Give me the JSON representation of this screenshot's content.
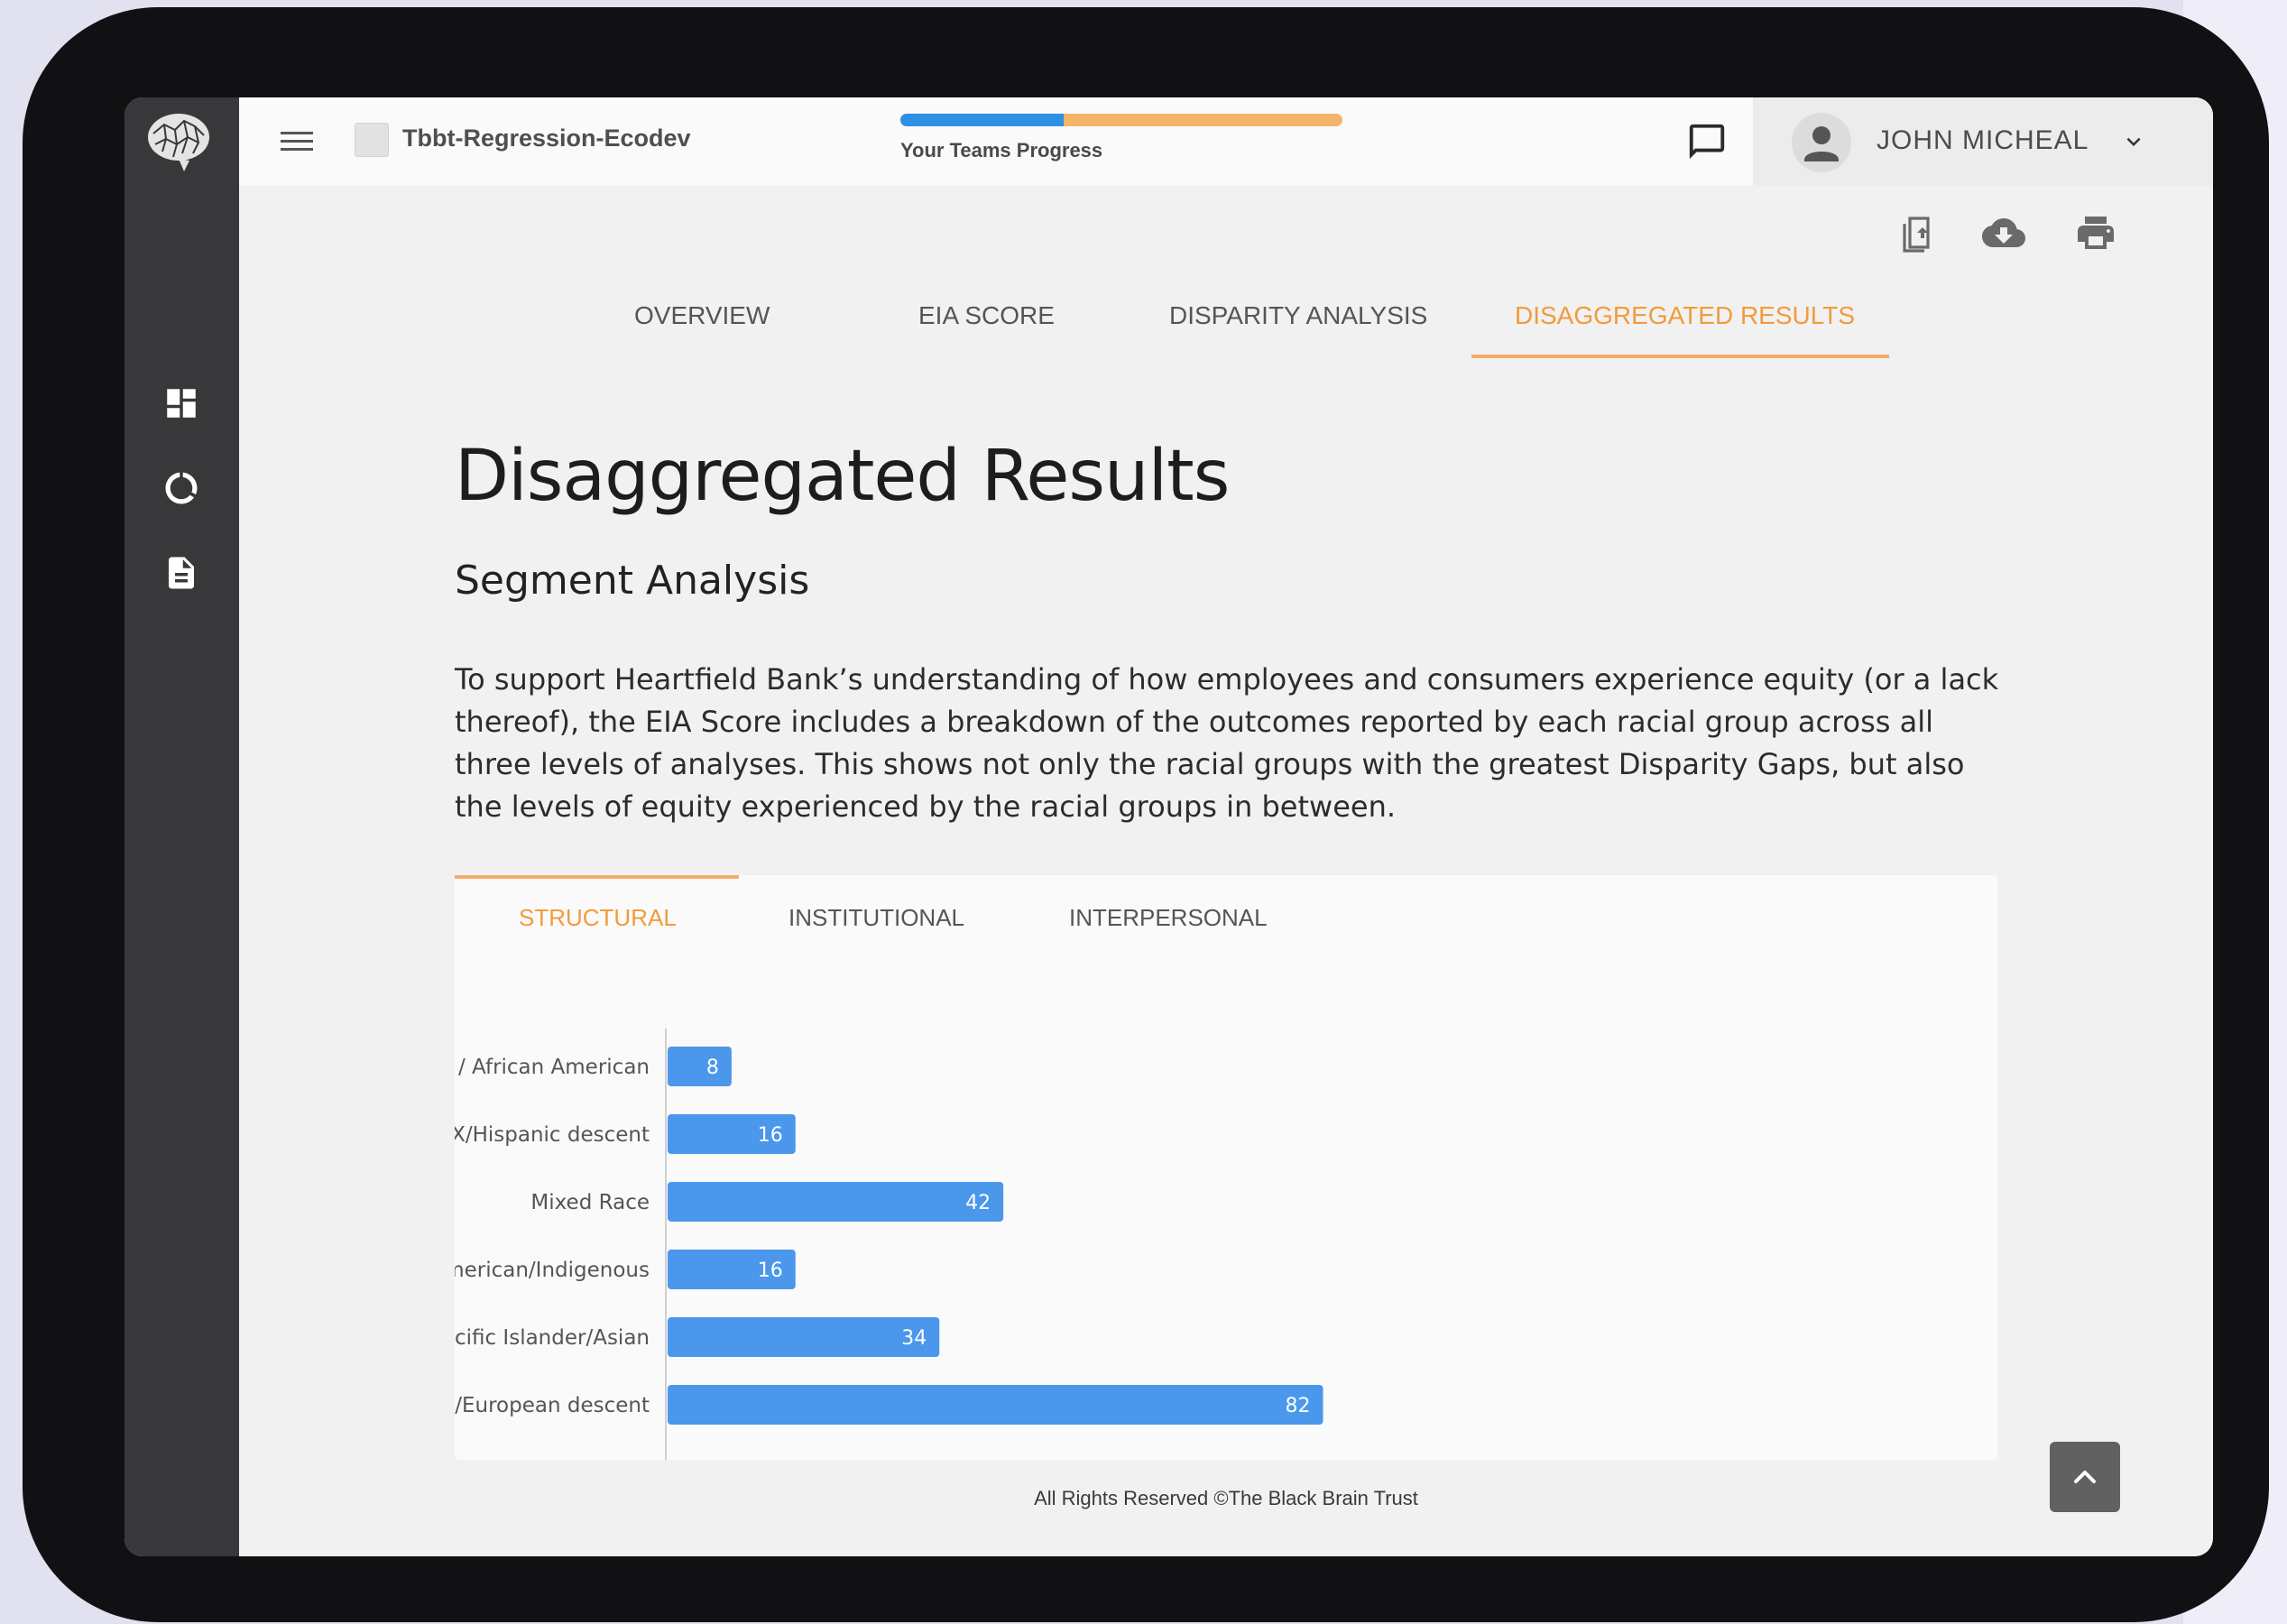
{
  "header": {
    "project_name": "Tbbt-Regression-Ecodev",
    "progress_label": "Your Teams Progress",
    "progress_fraction": 0.37,
    "user_name": "JOHN MICHEAL"
  },
  "tabs": [
    {
      "label": "OVERVIEW",
      "active": false
    },
    {
      "label": "EIA SCORE",
      "active": false
    },
    {
      "label": "DISPARITY ANALYSIS",
      "active": false
    },
    {
      "label": "DISAGGREGATED RESULTS",
      "active": true
    }
  ],
  "page": {
    "title": "Disaggregated Results",
    "subtitle": "Segment Analysis",
    "description": "To support Heartfield Bank’s understanding of how employees and consumers experience equity (or a lack thereof), the EIA Score includes a breakdown of the outcomes reported by each racial group across all three levels of analyses. This shows not only the racial groups with the greatest Disparity Gaps, but also the levels of equity experienced by the racial groups in between."
  },
  "sub_tabs": [
    {
      "label": "STRUCTURAL",
      "active": true
    },
    {
      "label": "INSTITUTIONAL",
      "active": false
    },
    {
      "label": "INTERPERSONAL",
      "active": false
    }
  ],
  "chart_data": {
    "type": "bar",
    "orientation": "horizontal",
    "categories": [
      "Black / African American",
      "LatinX/Hispanic descent",
      "Mixed Race",
      "Native American/Indigenous",
      "Pacific Islander/Asian",
      "White/European descent"
    ],
    "values": [
      8,
      16,
      42,
      16,
      34,
      82
    ],
    "data_labels": true,
    "xlim": [
      0,
      100
    ],
    "grid": false,
    "bar_color": "#4a97ec"
  },
  "footer": {
    "text": "All Rights Reserved ©The Black Brain Trust"
  },
  "colors": {
    "accent": "#f29b3c",
    "progress_done": "#2f8fe4",
    "progress_remaining": "#f4b56a",
    "sidebar": "#38383a"
  },
  "icons": {
    "logo": "brain-logo",
    "nav": [
      "dashboard-icon",
      "donut-chart-icon",
      "document-icon"
    ],
    "toolbar": [
      "chat-icon",
      "bell-icon"
    ],
    "actions": [
      "share-document-icon",
      "cloud-download-icon",
      "print-icon"
    ]
  }
}
